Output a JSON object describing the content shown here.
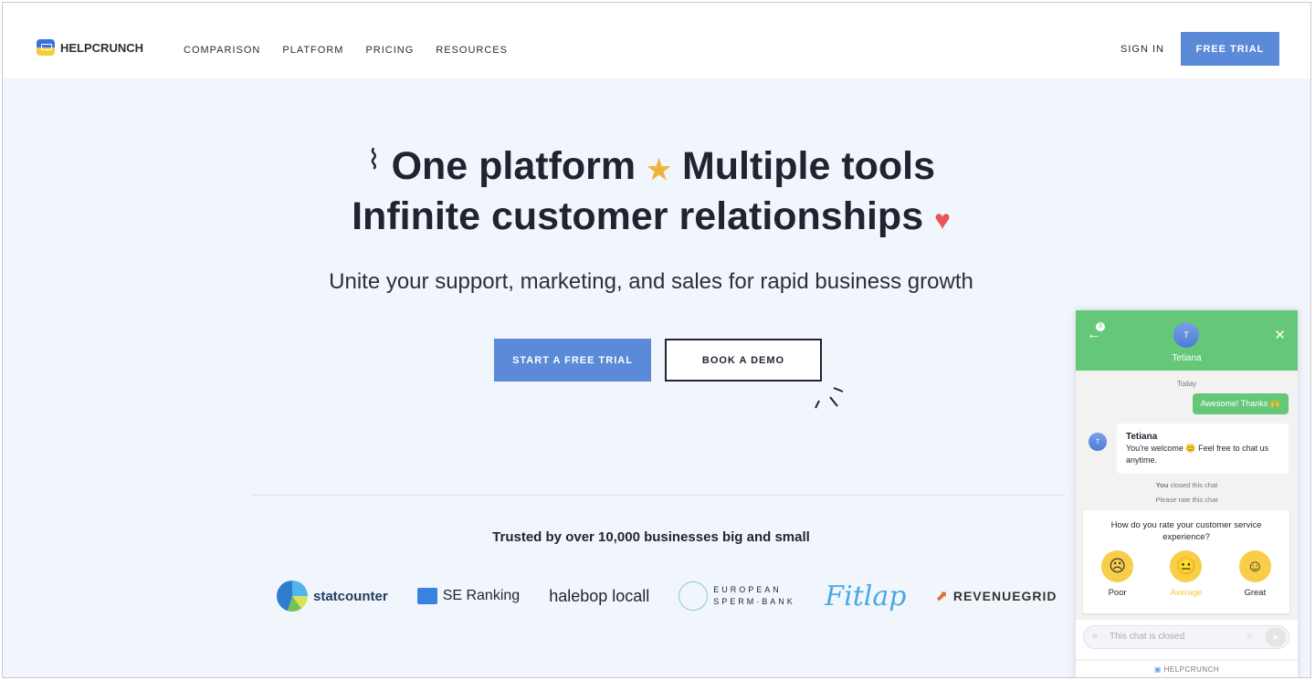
{
  "header": {
    "logo": "HELPCRUNCH",
    "nav": [
      "COMPARISON",
      "PLATFORM",
      "PRICING",
      "RESOURCES"
    ],
    "sign_in": "SIGN IN",
    "free_trial": "FREE TRIAL"
  },
  "hero": {
    "line1a": "One platform",
    "line1b": "Multiple tools",
    "line2": "Infinite customer relationships",
    "subtitle": "Unite your support, marketing, and sales for rapid business growth",
    "cta_primary": "START A FREE TRIAL",
    "cta_secondary": "BOOK A DEMO"
  },
  "trusted": {
    "title": "Trusted by over 10,000 businesses big and small",
    "logos": [
      "statcounter",
      "SE Ranking",
      "halebop locall",
      "EUROPEAN SPERM·BANK",
      "Fitlap",
      "REVENUEGRID"
    ]
  },
  "chat": {
    "agent_initial": "T",
    "agent_name": "Tetiana",
    "unread": "3",
    "date": "Today",
    "my_message": "Awesome! Thanks 🙌",
    "their_name": "Tetiana",
    "their_message": "You're welcome 😊 Feel free to chat us anytime.",
    "closed_by": "You",
    "closed_text": "closed this chat",
    "rate_prompt": "Please rate this chat",
    "rating_question": "How do you rate your customer service experience?",
    "ratings": [
      {
        "label": "Poor",
        "face": "☹"
      },
      {
        "label": "Average",
        "face": "😐"
      },
      {
        "label": "Great",
        "face": "☺"
      }
    ],
    "selected_rating": "Average",
    "input_placeholder": "This chat is closed",
    "powered_by": "HELPCRUNCH"
  },
  "colors": {
    "accent": "#5b8ad9",
    "chat_green": "#65c878",
    "rating_yellow": "#f8cd47"
  }
}
